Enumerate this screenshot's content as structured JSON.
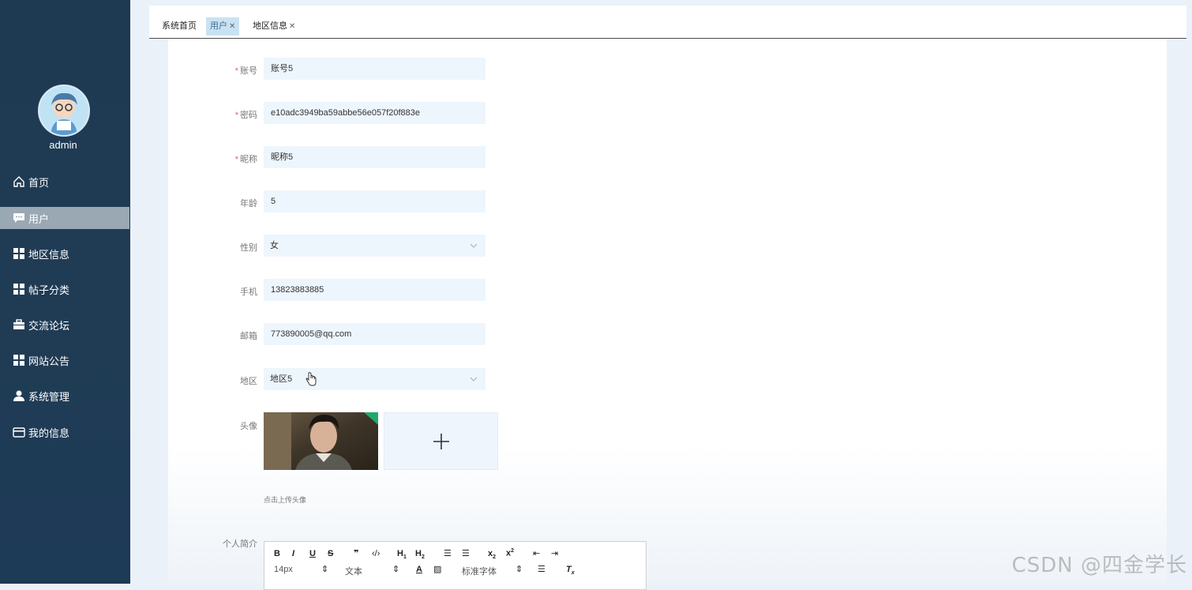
{
  "sidebar": {
    "username": "admin",
    "items": [
      {
        "label": "首页",
        "icon": "home-icon"
      },
      {
        "label": "用户",
        "icon": "chat-icon",
        "active": true
      },
      {
        "label": "地区信息",
        "icon": "grid-icon"
      },
      {
        "label": "帖子分类",
        "icon": "grid-icon"
      },
      {
        "label": "交流论坛",
        "icon": "briefcase-icon"
      },
      {
        "label": "网站公告",
        "icon": "grid-icon"
      },
      {
        "label": "系统管理",
        "icon": "person-icon"
      },
      {
        "label": "我的信息",
        "icon": "card-icon"
      }
    ]
  },
  "tabs": [
    {
      "label": "系统首页",
      "closable": false
    },
    {
      "label": "用户",
      "closable": true,
      "active": true
    },
    {
      "label": "地区信息",
      "closable": true
    }
  ],
  "form": {
    "account": {
      "label": "账号",
      "value": "账号5",
      "required": true
    },
    "password": {
      "label": "密码",
      "value": "e10adc3949ba59abbe56e057f20f883e",
      "required": true
    },
    "nickname": {
      "label": "昵称",
      "value": "昵称5",
      "required": true
    },
    "age": {
      "label": "年龄",
      "value": "5"
    },
    "gender": {
      "label": "性别",
      "value": "女"
    },
    "phone": {
      "label": "手机",
      "value": "13823883885"
    },
    "email": {
      "label": "邮箱",
      "value": "773890005@qq.com"
    },
    "region": {
      "label": "地区",
      "value": "地区5"
    },
    "avatar": {
      "label": "头像",
      "hint": "点击上传头像"
    },
    "bio": {
      "label": "个人简介"
    }
  },
  "editor": {
    "font_size": "14px",
    "paragraph": "文本",
    "font_family": "标准字体"
  },
  "watermark": "CSDN @四金学长",
  "colors": {
    "sidebar_bg": "#1e3a52",
    "active_nav": "#9aa8b3",
    "active_tab": "#c9e2f2",
    "field_bg": "#eef6fd",
    "required": "#e06060"
  }
}
